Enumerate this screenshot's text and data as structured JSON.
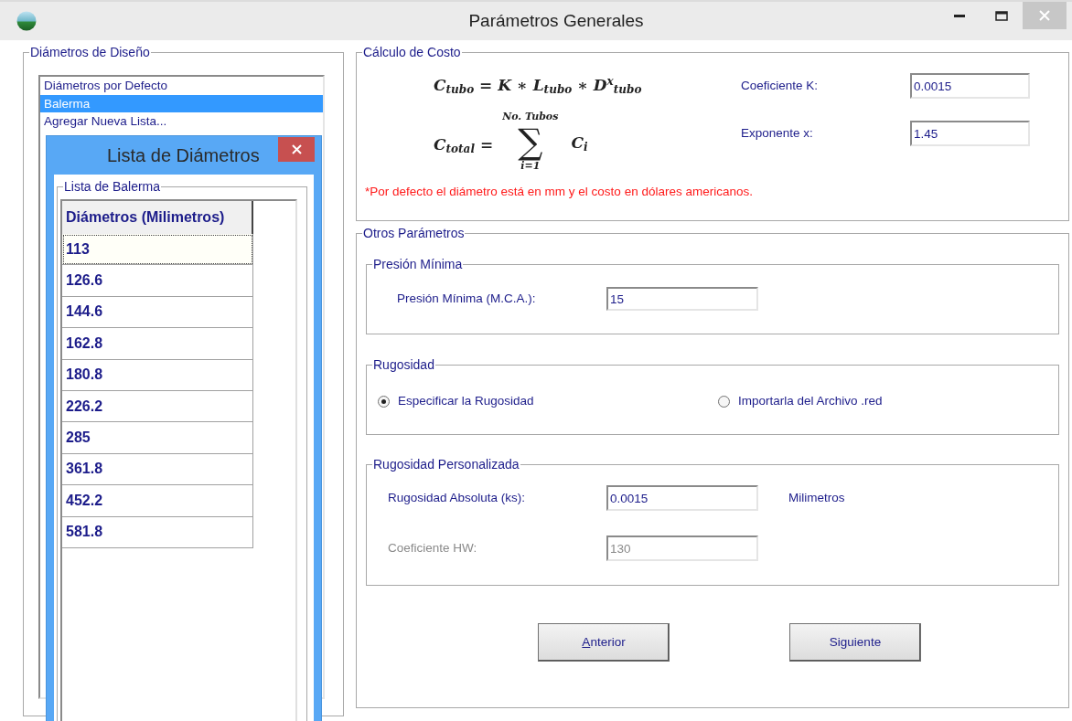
{
  "window": {
    "title": "Parámetros Generales"
  },
  "design_diameters": {
    "title": "Diámetros de Diseño",
    "items": [
      {
        "label": "Diámetros por Defecto",
        "selected": false
      },
      {
        "label": "Balerma",
        "selected": true
      },
      {
        "label": "Agregar Nueva Lista...",
        "selected": false
      }
    ]
  },
  "diameter_dialog": {
    "title": "Lista de Diámetros",
    "group_title": "Lista de Balerma",
    "column": "Diámetros (Milimetros)",
    "rows": [
      {
        "value": "113",
        "focused": true
      },
      {
        "value": "126.6",
        "focused": false
      },
      {
        "value": "144.6",
        "focused": false
      },
      {
        "value": "162.8",
        "focused": false
      },
      {
        "value": "180.8",
        "focused": false
      },
      {
        "value": "226.2",
        "focused": false
      },
      {
        "value": "285",
        "focused": false
      },
      {
        "value": "361.8",
        "focused": false
      },
      {
        "value": "452.2",
        "focused": false
      },
      {
        "value": "581.8",
        "focused": false
      }
    ]
  },
  "cost": {
    "title": "Cálculo de Costo",
    "formula_1": "C$_{tubo}$ = K ∗ L$_{tubo}$ ∗ D$^{x}$$_{tubo}$",
    "formula_2": {
      "left": "C$_{total}$ =",
      "upper": "No. Tubos",
      "sum": "∑",
      "lower": "i=1",
      "term": "C$_{i}$"
    },
    "fields": [
      {
        "label": "Coeficiente K:",
        "value": "0.0015"
      },
      {
        "label": "Exponente x:",
        "value": "1.45"
      }
    ],
    "note": "*Por defecto el diámetro está en mm y el costo en dólares americanos."
  },
  "other": {
    "title": "Otros Parámetros",
    "min_pressure": {
      "title": "Presión Mínima",
      "label": "Presión Mínima (M.C.A.):",
      "value": "15"
    },
    "roughness": {
      "title": "Rugosidad",
      "options": [
        {
          "label": "Especificar la Rugosidad",
          "selected": true
        },
        {
          "label": "Importarla del Archivo .red",
          "selected": false
        }
      ]
    },
    "custom": {
      "title": "Rugosidad Personalizada",
      "fields": [
        {
          "label": "Rugosidad Absoluta (ks):",
          "value": "0.0015",
          "unit": "Milimetros",
          "disabled": false
        },
        {
          "label": "Coeficiente HW:",
          "value": "130",
          "disabled": true
        }
      ]
    }
  },
  "buttons": [
    {
      "label": "Anterior",
      "access_key_underlined": true
    },
    {
      "label": "Siguiente",
      "access_key_underlined": false
    }
  ]
}
